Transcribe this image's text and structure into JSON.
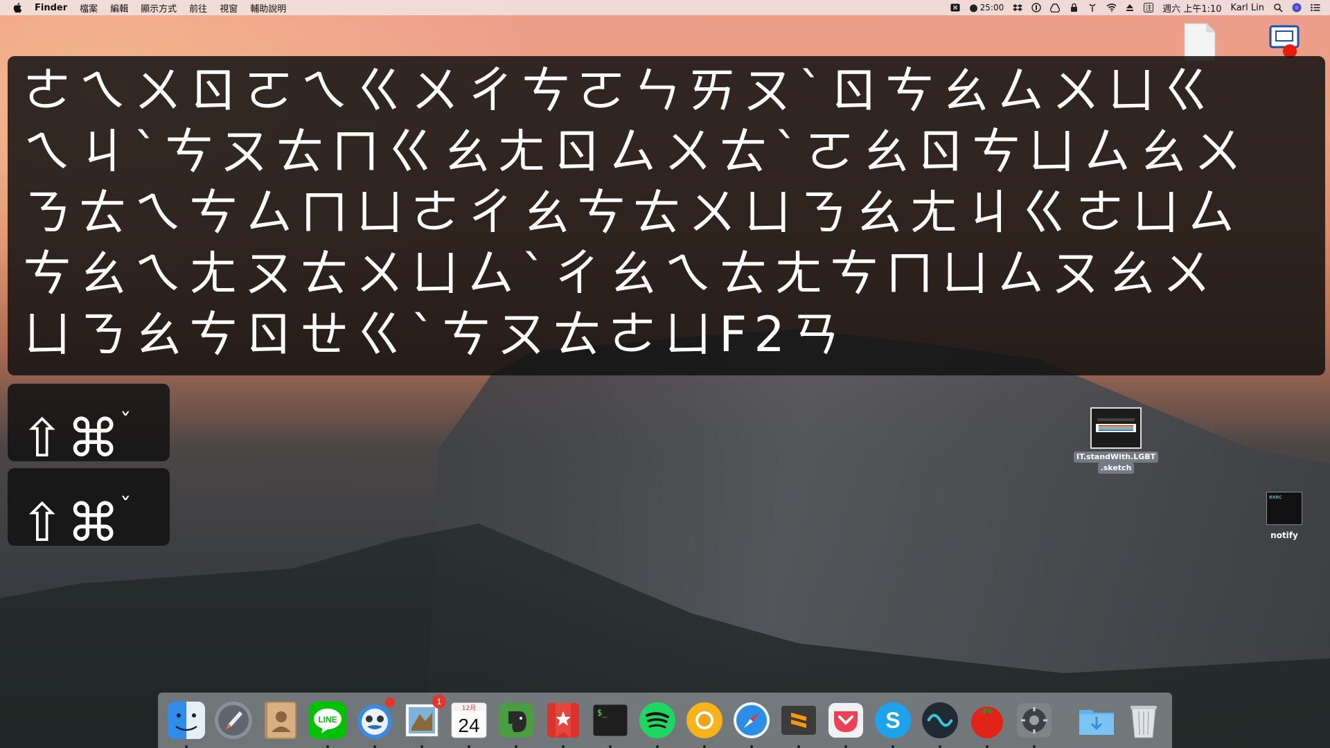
{
  "menubar": {
    "app_name": "Finder",
    "menus": [
      "檔案",
      "編輯",
      "顯示方式",
      "前往",
      "視窗",
      "輔助說明"
    ],
    "timer": "25:00",
    "datetime": "週六 上午1:10",
    "user": "Karl Lin"
  },
  "key_overlay": {
    "lines": [
      "ㄜㄟㄨㄖㄛㄟㄍㄨㄔㄘㄛㄣㄞㄡˋㄖㄘㄠㄙㄨㄩㄍ",
      "ㄟㄐˋㄘㄡㄊㄇㄍㄠㄤㄖㄙㄨㄊˋㄛㄠㄖㄘㄩㄙㄠㄨ",
      "ㄋㄊㄟㄘㄙㄇㄩㄜㄔㄠㄘㄊㄨㄩㄋㄠㄤㄐㄍㄜㄩㄙ",
      "ㄘㄠㄟㄤㄡㄊㄨㄩㄙˋㄔㄠㄟㄊㄤㄘㄇㄩㄙㄡㄠㄨ",
      "ㄩㄋㄠㄘㄖㄝㄍˋㄘㄡㄊㄜㄩF2ㄢ"
    ]
  },
  "combos": [
    {
      "keys": "⇧⌘",
      "mark": "ˇ"
    },
    {
      "keys": "⇧⌘",
      "mark": "ˇ"
    }
  ],
  "desktop": {
    "sketch_file": "IT.standWith.LGBT\n.sketch",
    "sketch_file_line1": "IT.standWith.LGBT",
    "sketch_file_line2": ".sketch",
    "exec_file": "notify",
    "exec_thumb_text": "exec"
  },
  "dock": {
    "apps": [
      {
        "name": "finder",
        "running": true
      },
      {
        "name": "launchpad",
        "running": false
      },
      {
        "name": "contacts",
        "running": false
      },
      {
        "name": "line",
        "running": true
      },
      {
        "name": "tweetbot",
        "running": true,
        "badge": ""
      },
      {
        "name": "mail",
        "running": true,
        "badge": "1"
      },
      {
        "name": "calendar",
        "running": true,
        "month": "12月",
        "day": "24"
      },
      {
        "name": "evernote",
        "running": true
      },
      {
        "name": "wunderlist",
        "running": true
      },
      {
        "name": "terminal",
        "running": true
      },
      {
        "name": "spotify",
        "running": true
      },
      {
        "name": "chrome-canary",
        "running": true
      },
      {
        "name": "safari",
        "running": true
      },
      {
        "name": "sublime-text",
        "running": true
      },
      {
        "name": "pocket",
        "running": true
      },
      {
        "name": "skype",
        "running": true
      },
      {
        "name": "wavebox",
        "running": true
      },
      {
        "name": "tomato-timer",
        "running": true
      },
      {
        "name": "system-preferences",
        "running": true
      }
    ],
    "line_label": "LINE",
    "calendar_month": "12月",
    "calendar_day": "24",
    "mail_badge": "1"
  },
  "colors": {
    "overlay_bg": "#111111",
    "badge": "#e3352e",
    "spotify": "#1ed760",
    "line": "#00c300"
  }
}
